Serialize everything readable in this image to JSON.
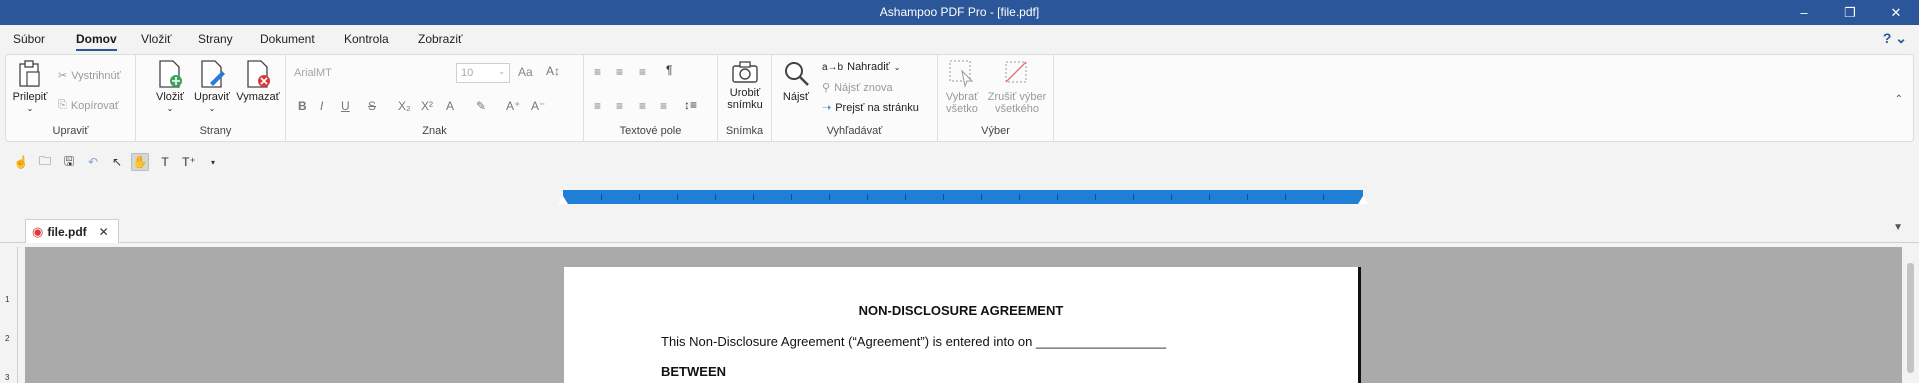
{
  "window": {
    "title": "Ashampoo PDF Pro - [file.pdf]"
  },
  "menu": {
    "tabs": [
      "Súbor",
      "Domov",
      "Vložiť",
      "Strany",
      "Dokument",
      "Kontrola",
      "Zobraziť"
    ],
    "active": "Domov"
  },
  "ribbon": {
    "upravit": {
      "label": "Upraviť",
      "paste": "Prilepiť",
      "cut": "Vystrihnúť",
      "copy": "Kopírovať"
    },
    "strany": {
      "label": "Strany",
      "insert": "Vložiť",
      "edit": "Upraviť",
      "delete": "Vymazať"
    },
    "znak": {
      "label": "Znak",
      "font_name": "ArialMT",
      "font_size": "10"
    },
    "textove_pole": {
      "label": "Textové pole"
    },
    "snimka": {
      "label": "Snímka",
      "capture_line1": "Urobiť",
      "capture_line2": "snímku"
    },
    "vyhladavat": {
      "label": "Vyhľadávať",
      "find": "Nájsť",
      "replace": "Nahradiť",
      "find_again": "Nájsť znova",
      "goto_page": "Prejsť na stránku"
    },
    "vyber": {
      "label": "Výber",
      "select_all_line1": "Vybrať",
      "select_all_line2": "všetko",
      "deselect_line1": "Zrušiť výber",
      "deselect_line2": "všetkého"
    }
  },
  "document_tab": {
    "name": "file.pdf"
  },
  "vertical_ruler": [
    "1",
    "2",
    "3"
  ],
  "document": {
    "heading": "NON-DISCLOSURE AGREEMENT",
    "intro": "This Non-Disclosure Agreement (“Agreement”) is entered into on __________________",
    "between": "BETWEEN"
  },
  "colors": {
    "titlebar": "#2b579a",
    "ruler": "#1f7fd6",
    "workspace": "#aaaaaa"
  }
}
